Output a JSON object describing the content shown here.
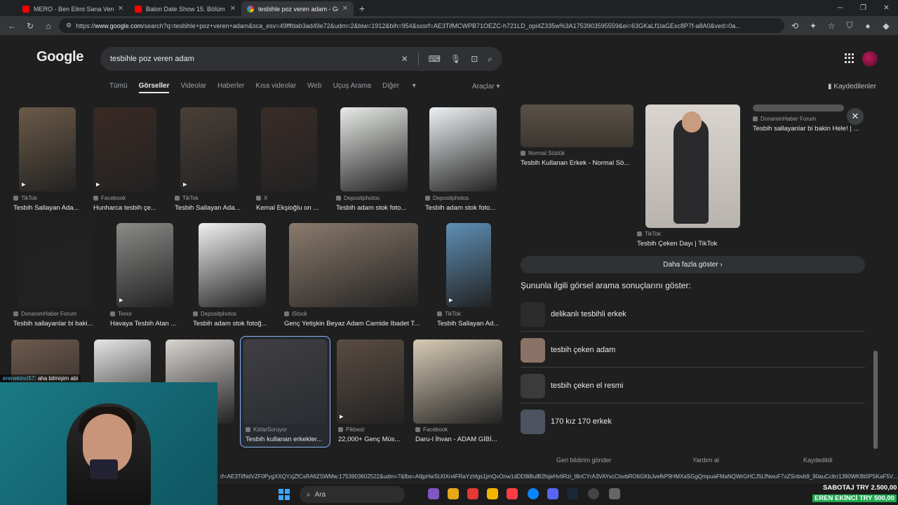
{
  "browser": {
    "tabs": [
      {
        "title": "MERO - Ben Elimi Sana Verdim (O",
        "active": false,
        "icon": "youtube-icon"
      },
      {
        "title": "Balon Date Show 15. Bölüm - You",
        "active": false,
        "icon": "youtube-icon"
      },
      {
        "title": "tesbihle poz veren adam - Google",
        "active": true,
        "icon": "google-icon"
      }
    ],
    "url_prefix": "https://",
    "url_host": "www.google.com",
    "url_rest": "/search?q=tesbihle+poz+veren+adam&sca_esv=49fffdab3ad49e72&udm=2&biw=1912&bih=954&sxsrf=AE3TifMCWPB71OEZC-h721LD_opi4Z335w%3A1753903595559&ei=63GKaLf1IaGExc8P7f-a8A0&ved=0a...",
    "status_url": "rf=AE3TifNdVZF0PygXXQYzjZfCsRAfiZSWMw:1753903602522&udm=7&fbs=AIljpHwSU0Xn4FRaYzhfgs1jmQvOnw1dDD9iBulB2fsjeHv6Rzi_t8nCYrA3VAYvcClsvbRO6GKbJvefkP9HMXaSGgQmpuaFMaNQWrGHCJ5LfNwuF7oZSnbvb9_90auCcltrr1390WKBt0PSKaF5V..."
  },
  "google": {
    "logo": "Google",
    "query": "tesbihle poz veren adam",
    "nav_tabs": [
      "Tümü",
      "Görseller",
      "Videolar",
      "Haberler",
      "Kısa videolar",
      "Web",
      "Uçuş Arama",
      "Diğer"
    ],
    "selected_tab": "Görseller",
    "tools": "Araçlar",
    "saved": "Kaydedilenler"
  },
  "results": {
    "row1": [
      {
        "source": "TikTok",
        "caption": "Tesbih Sallayan Ada...",
        "video": true,
        "color": "#6b5a48"
      },
      {
        "source": "Facebook",
        "caption": "Hunharca tesbih çe...",
        "video": true,
        "color": "#3a2a24"
      },
      {
        "source": "TikTok",
        "caption": "Tesbih Sallayan Ada...",
        "video": true,
        "color": "#4a3f38"
      },
      {
        "source": "X",
        "caption": "Kemal Ekşioğlu on ...",
        "video": false,
        "color": "#3a2c28"
      },
      {
        "source": "Depositphotos",
        "caption": "Tesbih adam stok foto...",
        "video": false,
        "color": "#e8ebe7"
      },
      {
        "source": "Depositphotos",
        "caption": "Tesbih adam stok foto...",
        "video": false,
        "color": "#eef1f3"
      }
    ],
    "row2": [
      {
        "source": "DonanimHaber Forum",
        "caption": "Tesbih sallayanlar bi baki...",
        "video": false,
        "color": "#202020"
      },
      {
        "source": "Tenor",
        "caption": "Havaya Tesbih Atan ...",
        "video": true,
        "color": "#8a8c88"
      },
      {
        "source": "Depositphotos",
        "caption": "Tesbih adam stok fotoğ...",
        "video": false,
        "color": "#f1f1f1"
      },
      {
        "source": "iStock",
        "caption": "Genç Yetişkin Beyaz Adam Camide Ibadet T...",
        "video": false,
        "color": "#8a7a6c"
      },
      {
        "source": "TikTok",
        "caption": "Tesbih Sallayan Ad...",
        "video": true,
        "color": "#5e8fb5"
      }
    ],
    "row3": [
      {
        "source": "",
        "caption": "",
        "video": false,
        "color": "#6e5a4d"
      },
      {
        "source": "",
        "caption": "",
        "video": false,
        "color": "#e6e6e6"
      },
      {
        "source": "",
        "caption": "",
        "video": false,
        "color": "#d8d4d0"
      },
      {
        "source": "KizlarSoruyor",
        "caption": "Tesbih kullanan erkekler...",
        "video": false,
        "color": "#3a3634"
      },
      {
        "source": "Pikbest",
        "caption": "22,000+ Genç Müs...",
        "video": true,
        "color": "#5a4c42"
      },
      {
        "source": "Facebook",
        "caption": "Daru-l İhvan - ADAM GİBİ...",
        "video": false,
        "color": "#d7cbb5"
      }
    ]
  },
  "panel": {
    "items": [
      {
        "source": "Normal Sözlük",
        "caption": "Tesbih Kullanan Erkek - Normal Sö..."
      },
      {
        "source": "TikTok",
        "caption": "Tesbih Çeken Dayı | TikTok"
      },
      {
        "source": "DonanimHaber Forum",
        "caption": "Tesbih sallayanlar bi bakin Hele! | ..."
      }
    ],
    "more": "Daha fazla göster",
    "related_title": "Şununla ilgili görsel arama sonuçlarını göster:",
    "related": [
      "delikanlı tesbihli erkek",
      "tesbih çeken adam",
      "tesbih çeken el resmi",
      "170 kız 170 erkek"
    ],
    "footer": [
      "Geri bildirim gönder",
      "Yardım al",
      "Kaydedildi"
    ]
  },
  "stream": {
    "chat_user": "erenekinci57",
    "chat_text": ": aha bilmişim abi",
    "overlay1": "SABOTAJ  TRY 2.500,00",
    "overlay2": "EREN EKİNCİ  TRY 500,00"
  },
  "taskbar": {
    "search": "Ara"
  }
}
